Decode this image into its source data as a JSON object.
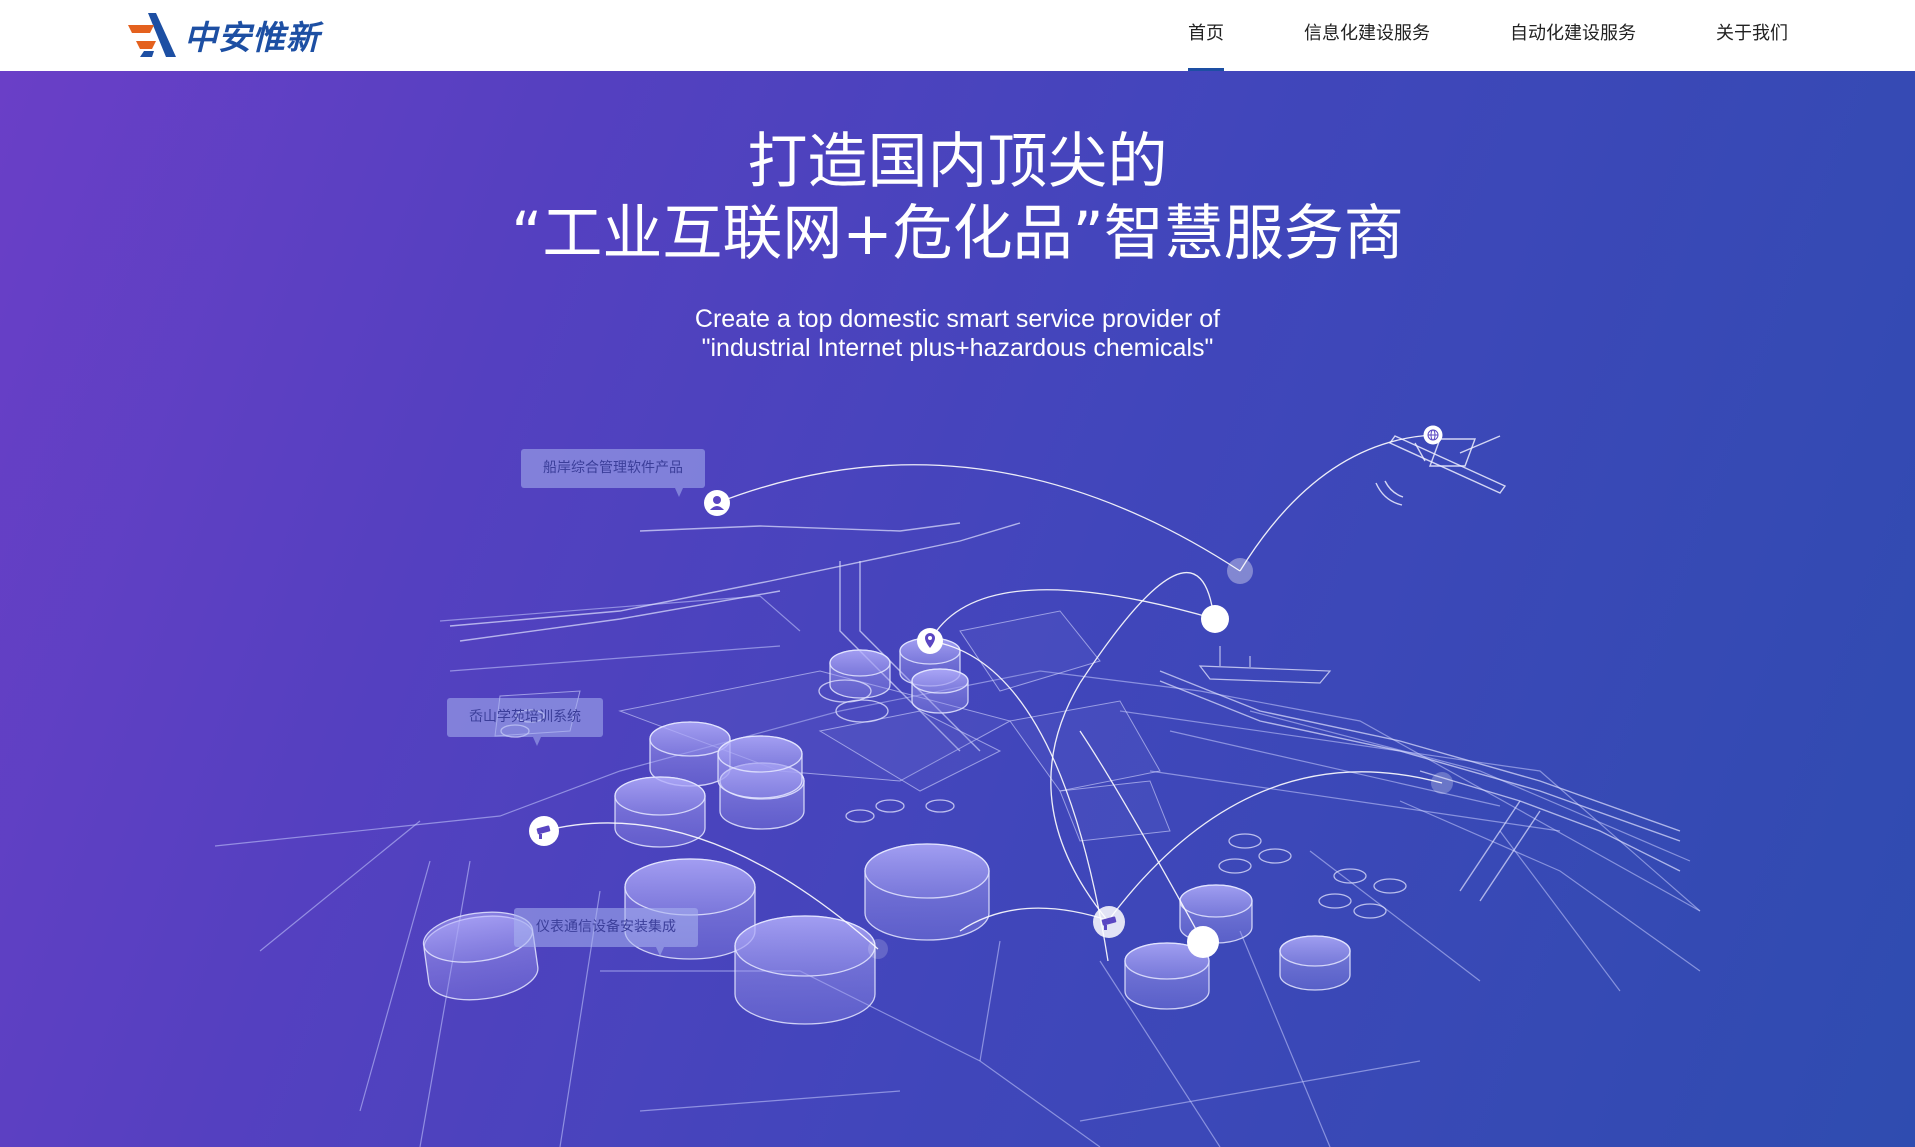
{
  "brand": {
    "name": "中安惟新",
    "colors": {
      "primary": "#1d4fa3",
      "accent": "#e4611e"
    }
  },
  "nav": {
    "items": [
      {
        "label": "首页",
        "active": true
      },
      {
        "label": "信息化建设服务",
        "active": false
      },
      {
        "label": "自动化建设服务",
        "active": false
      },
      {
        "label": "关于我们",
        "active": false
      }
    ]
  },
  "hero": {
    "title_line1": "打造国内顶尖的",
    "title_line2": "“工业互联网+危化品”智慧服务商",
    "subtitle_line1": "Create a top domestic smart service provider of",
    "subtitle_line2": "\"industrial Internet plus+hazardous chemicals\"",
    "tags": [
      {
        "label": "船岸综合管理软件产品"
      },
      {
        "label": "岙山学苑培训系统"
      },
      {
        "label": "仪表通信设备安装集成"
      }
    ],
    "markers": [
      {
        "icon": "user-icon"
      },
      {
        "icon": "location-pin-icon"
      },
      {
        "icon": "camera-icon"
      },
      {
        "icon": "camera-icon"
      },
      {
        "icon": "globe-icon"
      }
    ],
    "illustration": "industrial-port-isometric-illustration"
  }
}
